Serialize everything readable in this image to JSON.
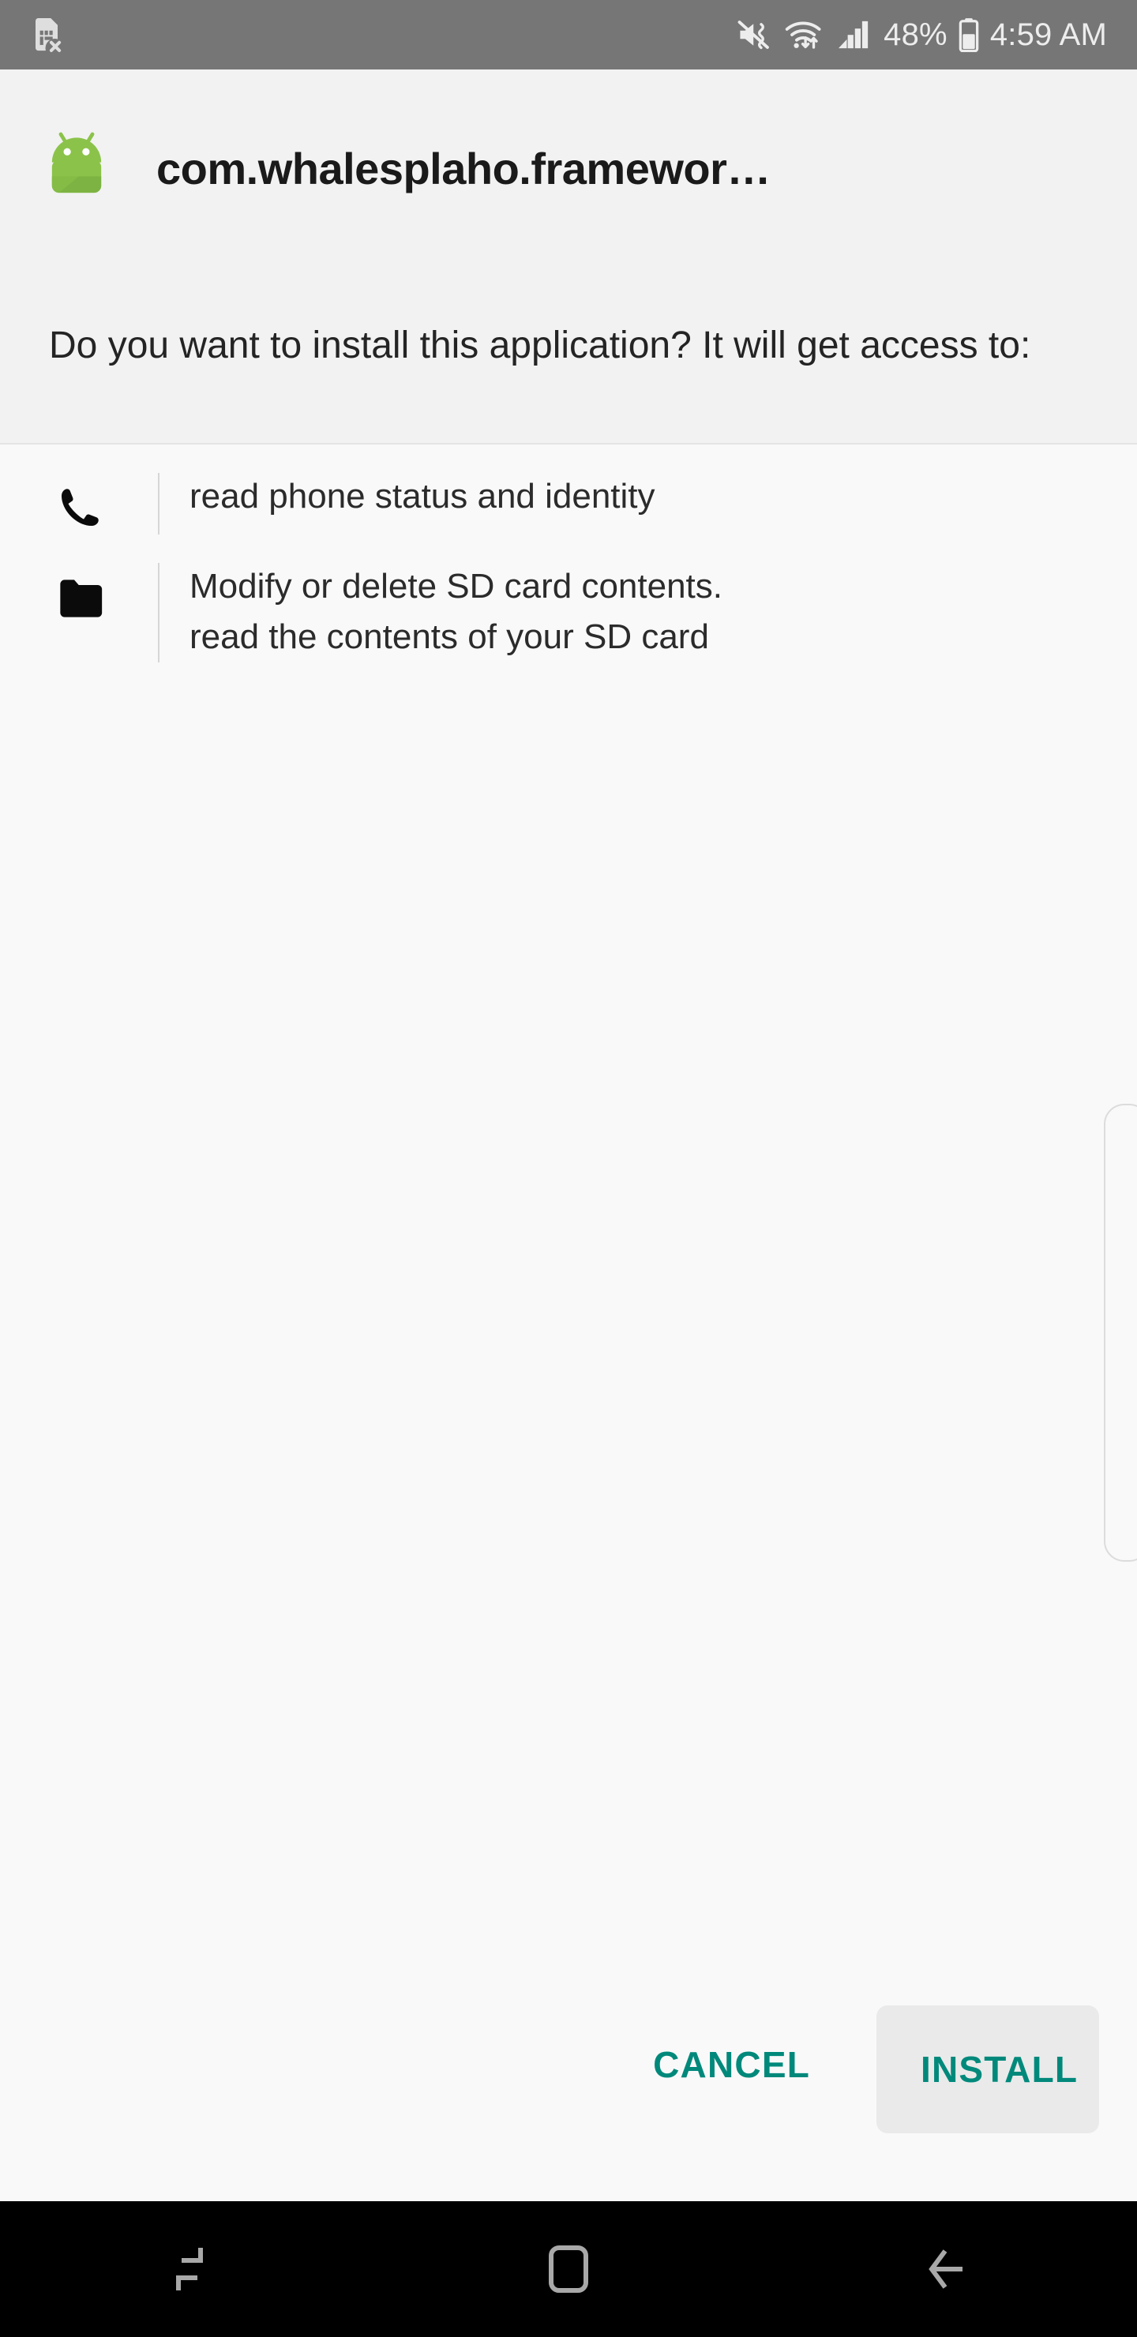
{
  "status_bar": {
    "left_icons": [
      {
        "name": "sim-card-error-icon",
        "label": "SIM card error"
      }
    ],
    "right_icons": [
      {
        "name": "mute-vibrate-icon",
        "label": "Sound off / vibrate"
      },
      {
        "name": "wifi-data-icon",
        "label": "Wi-Fi with data transfer"
      },
      {
        "name": "cellular-signal-icon",
        "label": "Cellular signal"
      }
    ],
    "battery_percent": "48%",
    "battery_icon": "battery-icon",
    "time": "4:59 AM",
    "background_color": "#767676",
    "foreground_color": "#EDEDED"
  },
  "header": {
    "app_icon": "android-robot-icon",
    "app_icon_color": "#8BC34A",
    "package_name": "com.whalesplaho.framewor…",
    "install_question": "Do you want to install this application? It will get access to:",
    "background_color": "#F2F2F2"
  },
  "permissions": {
    "items": [
      {
        "icon": "phone-handset-icon",
        "lines": [
          "read phone status and identity"
        ]
      },
      {
        "icon": "folder-icon",
        "lines": [
          "Modify or delete SD card contents.",
          "read the contents of your SD card"
        ]
      }
    ],
    "background_color": "#F9F9F9"
  },
  "scrollbar": {
    "name": "scroll-indicator",
    "color": "#DCDCDC"
  },
  "actions": {
    "cancel_label": "CANCEL",
    "install_label": "INSTALL",
    "accent_color": "#00897B",
    "install_button_background": "#EAEAEA"
  },
  "navigation_bar": {
    "background_color": "#000000",
    "icon_color": "#A8A8A8",
    "buttons": [
      {
        "name": "recents-button",
        "label": "Recents"
      },
      {
        "name": "home-button",
        "label": "Home"
      },
      {
        "name": "back-button",
        "label": "Back"
      }
    ]
  }
}
